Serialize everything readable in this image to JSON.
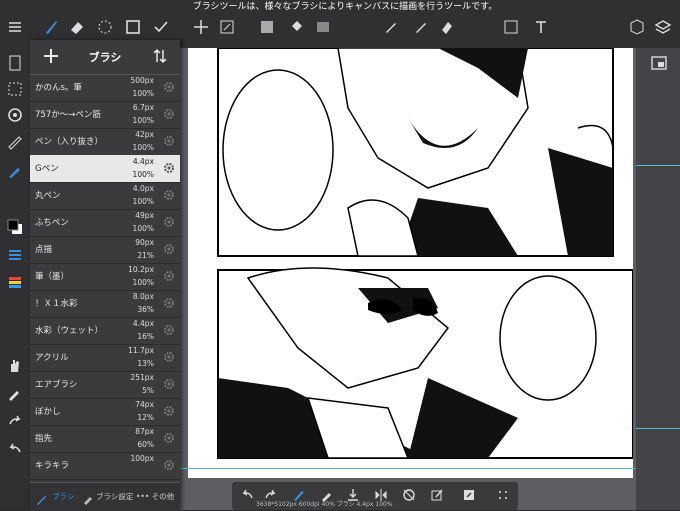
{
  "tooltip": "ブラシツールは、様々なブラシによりキャンバスに描画を行うツールです。",
  "panel": {
    "title": "ブラシ",
    "brushes": [
      {
        "name": "かのんs。筆",
        "size": "500px",
        "opacity": "100%"
      },
      {
        "name": "757か～→ペン筋",
        "size": "6.7px",
        "opacity": "100%"
      },
      {
        "name": "ペン（入り抜き）",
        "size": "42px",
        "opacity": "100%"
      },
      {
        "name": "Gペン",
        "size": "4.4px",
        "opacity": "100%",
        "selected": true
      },
      {
        "name": "丸ペン",
        "size": "4.0px",
        "opacity": "100%"
      },
      {
        "name": "ふちペン",
        "size": "49px",
        "opacity": "100%"
      },
      {
        "name": "点描",
        "size": "90px",
        "opacity": "21%"
      },
      {
        "name": "筆（墨）",
        "size": "10.2px",
        "opacity": "100%"
      },
      {
        "name": "！Ｘ１水彩",
        "size": "8.0px",
        "opacity": "36%"
      },
      {
        "name": "水彩（ウェット）",
        "size": "4.4px",
        "opacity": "16%"
      },
      {
        "name": "アクリル",
        "size": "11.7px",
        "opacity": "13%"
      },
      {
        "name": "エアブラシ",
        "size": "251px",
        "opacity": "5%"
      },
      {
        "name": "ぼかし",
        "size": "74px",
        "opacity": "12%"
      },
      {
        "name": "指先",
        "size": "87px",
        "opacity": "60%"
      },
      {
        "name": "キラキラ",
        "size": "100px",
        "opacity": ""
      }
    ],
    "footer": {
      "brush_tab": "ブラシ",
      "settings_tab": "ブラシ設定",
      "more_tab": "••• その他"
    }
  },
  "status": "3638*5102px 600dpi 40% ブラシ 4.4px 100%",
  "colors": {
    "accent": "#3b8fe0",
    "toolbar": "#303033",
    "panel": "#3b3b3e"
  }
}
